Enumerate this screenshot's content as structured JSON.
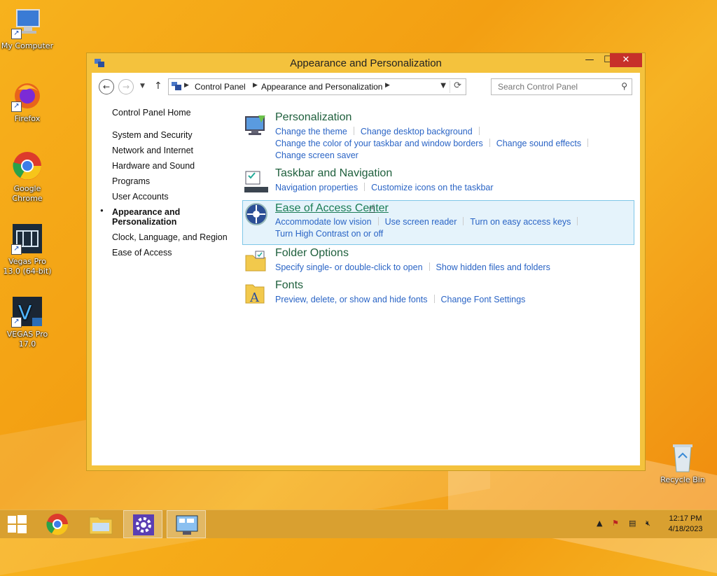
{
  "desktop": {
    "icons": [
      {
        "label": "My Computer"
      },
      {
        "label": "Firefox"
      },
      {
        "label": "Google Chrome"
      },
      {
        "label": "Vegas Pro 13.0 (64-bit)"
      },
      {
        "label": "VEGAS Pro 17.0"
      },
      {
        "label": "Recycle Bin"
      }
    ]
  },
  "window": {
    "title": "Appearance and Personalization",
    "controls": {
      "minimize": "—",
      "maximize": "☐",
      "close": "✕"
    }
  },
  "address_bar": {
    "breadcrumbs": [
      "Control Panel",
      "Appearance and Personalization"
    ]
  },
  "search": {
    "placeholder": "Search Control Panel"
  },
  "left_nav": {
    "home": "Control Panel Home",
    "items": [
      "System and Security",
      "Network and Internet",
      "Hardware and Sound",
      "Programs",
      "User Accounts"
    ],
    "current": "Appearance and Personalization",
    "items_after": [
      "Clock, Language, and Region",
      "Ease of Access"
    ]
  },
  "categories": [
    {
      "title": "Personalization",
      "links": [
        "Change the theme",
        "Change desktop background",
        "Change the color of your taskbar and window borders",
        "Change sound effects",
        "Change screen saver"
      ]
    },
    {
      "title": "Taskbar and Navigation",
      "links": [
        "Navigation properties",
        "Customize icons on the taskbar"
      ]
    },
    {
      "title": "Ease of Access Center",
      "links": [
        "Accommodate low vision",
        "Use screen reader",
        "Turn on easy access keys",
        "Turn High Contrast on or off"
      ]
    },
    {
      "title": "Folder Options",
      "links": [
        "Specify single- or double-click to open",
        "Show hidden files and folders"
      ]
    },
    {
      "title": "Fonts",
      "links": [
        "Preview, delete, or show and hide fonts",
        "Change Font Settings"
      ]
    }
  ],
  "taskbar": {
    "clock": {
      "time": "12:17 PM",
      "date": "4/18/2023"
    }
  },
  "colors": {
    "accent": "#f4c23d",
    "link": "#2a64c5",
    "category_title": "#1e5f3c",
    "close": "#c7302a"
  }
}
